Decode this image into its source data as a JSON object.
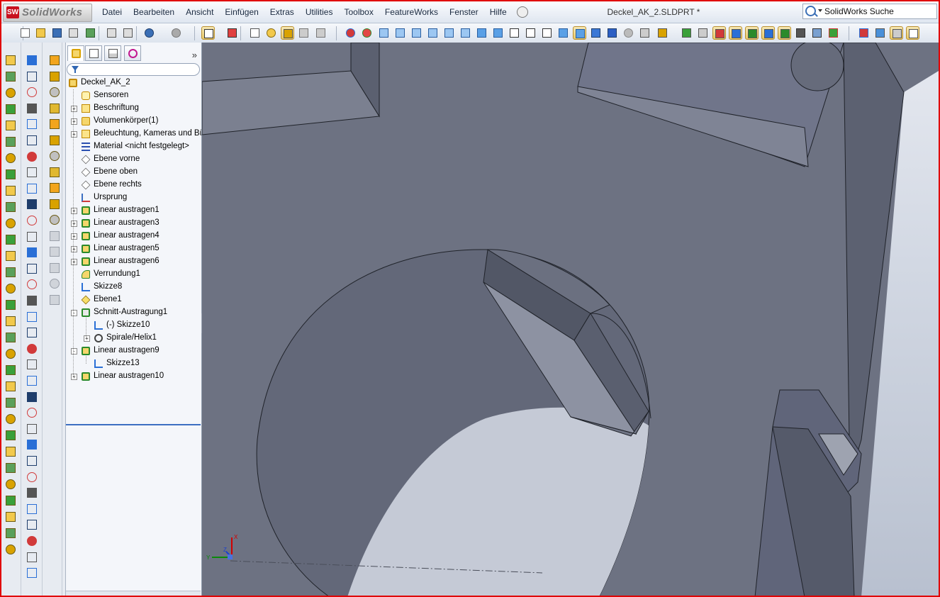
{
  "app": {
    "logo_text": "SolidWorks",
    "logo_mark": "SW",
    "document_title": "Deckel_AK_2.SLDPRT *",
    "search_placeholder": "SolidWorks Suche"
  },
  "menu": [
    "Datei",
    "Bearbeiten",
    "Ansicht",
    "Einfügen",
    "Extras",
    "Utilities",
    "Toolbox",
    "FeatureWorks",
    "Fenster",
    "Hilfe"
  ],
  "feature_tree": {
    "expand_symbol": "»",
    "items": [
      {
        "label": "Deckel_AK_2",
        "icon": "part-icon",
        "level": 0,
        "expander": ""
      },
      {
        "label": "Sensoren",
        "icon": "sensor-icon",
        "level": 1,
        "expander": ""
      },
      {
        "label": "Beschriftung",
        "icon": "annotation-icon",
        "level": 1,
        "expander": "+"
      },
      {
        "label": "Volumenkörper(1)",
        "icon": "solid-bodies-icon",
        "level": 1,
        "expander": "+"
      },
      {
        "label": "Beleuchtung, Kameras und Bühne",
        "icon": "lights-icon",
        "level": 1,
        "expander": "+"
      },
      {
        "label": "Material <nicht festgelegt>",
        "icon": "material-icon",
        "level": 1,
        "expander": ""
      },
      {
        "label": "Ebene vorne",
        "icon": "plane-icon",
        "level": 1,
        "expander": ""
      },
      {
        "label": "Ebene oben",
        "icon": "plane-icon",
        "level": 1,
        "expander": ""
      },
      {
        "label": "Ebene rechts",
        "icon": "plane-icon",
        "level": 1,
        "expander": ""
      },
      {
        "label": "Ursprung",
        "icon": "origin-icon",
        "level": 1,
        "expander": ""
      },
      {
        "label": "Linear austragen1",
        "icon": "extrude-icon",
        "level": 1,
        "expander": "+"
      },
      {
        "label": "Linear austragen3",
        "icon": "extrude-icon",
        "level": 1,
        "expander": "+"
      },
      {
        "label": "Linear austragen4",
        "icon": "extrude-icon",
        "level": 1,
        "expander": "+"
      },
      {
        "label": "Linear austragen5",
        "icon": "extrude-icon",
        "level": 1,
        "expander": "+"
      },
      {
        "label": "Linear austragen6",
        "icon": "extrude-icon",
        "level": 1,
        "expander": "+"
      },
      {
        "label": "Verrundung1",
        "icon": "fillet-icon",
        "level": 1,
        "expander": ""
      },
      {
        "label": "Skizze8",
        "icon": "sketch-icon",
        "level": 1,
        "expander": ""
      },
      {
        "label": "Ebene1",
        "icon": "plane-yellow-icon",
        "level": 1,
        "expander": ""
      },
      {
        "label": "Schnitt-Austragung1",
        "icon": "swept-cut-icon",
        "level": 1,
        "expander": "-"
      },
      {
        "label": "(-) Skizze10",
        "icon": "sketch-icon",
        "level": 2,
        "expander": ""
      },
      {
        "label": "Spirale/Helix1",
        "icon": "helix-icon",
        "level": 2,
        "expander": "+"
      },
      {
        "label": "Linear austragen9",
        "icon": "extrude-icon",
        "level": 1,
        "expander": "-"
      },
      {
        "label": "Skizze13",
        "icon": "sketch-icon",
        "level": 2,
        "expander": ""
      },
      {
        "label": "Linear austragen10",
        "icon": "extrude-icon",
        "level": 1,
        "expander": "+"
      }
    ]
  },
  "triad": {
    "x_label": "X",
    "y_label": "Y",
    "z_label": "Z"
  },
  "colors": {
    "model_face": "#6e7383",
    "model_face_dark": "#5f6474",
    "model_face_light": "#878c9b",
    "accent_red": "#e00000",
    "selection_blue": "#3c6fc2"
  }
}
